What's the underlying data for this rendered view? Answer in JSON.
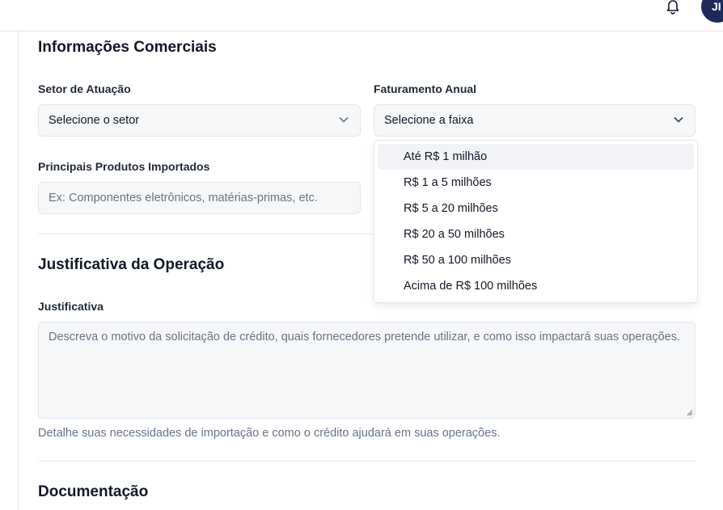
{
  "header": {
    "avatar_initials": "JI",
    "bell_icon": "bell-icon"
  },
  "sections": {
    "commercial": {
      "title": "Informações Comerciais",
      "sector_label": "Setor de Atuação",
      "sector_value": "Selecione o setor",
      "revenue_label": "Faturamento Anual",
      "revenue_value": "Selecione a faixa",
      "products_label": "Principais Produtos Importados",
      "products_placeholder": "Ex: Componentes eletrônicos, matérias-primas, etc."
    },
    "justification": {
      "title": "Justificativa da Operação",
      "label": "Justificativa",
      "placeholder": "Descreva o motivo da solicitação de crédito, quais fornecedores pretende utilizar, e como isso impactará suas operações.",
      "hint": "Detalhe suas necessidades de importação e como o crédito ajudará em suas operações."
    },
    "documentation": {
      "title": "Documentação"
    }
  },
  "revenue_dropdown": {
    "options": [
      "Até R$ 1 milhão",
      "R$ 1 a 5 milhões",
      "R$ 5 a 20 milhões",
      "R$ 20 a 50 milhões",
      "R$ 50 a 100 milhões",
      "Acima de R$ 100 milhões"
    ],
    "highlighted": "Até R$ 1 milhão"
  }
}
